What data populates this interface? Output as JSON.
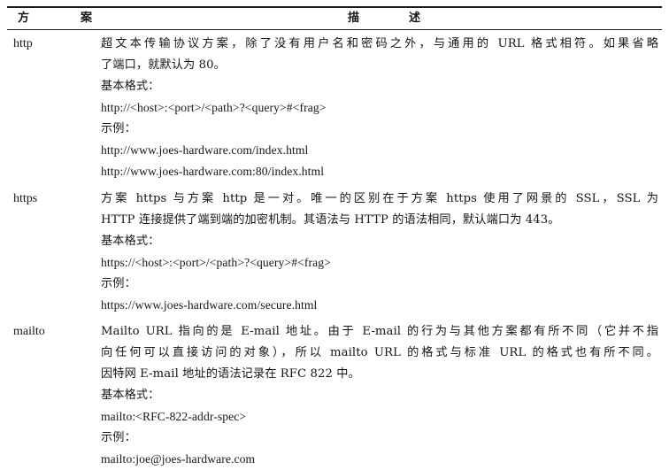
{
  "table": {
    "headers": {
      "scheme": [
        "方",
        "案"
      ],
      "description": [
        "描",
        "述"
      ]
    },
    "rows": [
      {
        "scheme": "http",
        "lines": [
          "超文本传输协议方案，除了没有用户名和密码之外，与通用的 URL 格式相符。如果省略",
          "了端口，就默认为 80。",
          "基本格式：",
          "http://<host>:<port>/<path>?<query>#<frag>",
          "示例：",
          "http://www.joes-hardware.com/index.html",
          "http://www.joes-hardware.com:80/index.html"
        ]
      },
      {
        "scheme": "https",
        "lines": [
          "方案 https 与方案 http 是一对。唯一的区别在于方案 https 使用了网景的 SSL，SSL 为",
          "HTTP 连接提供了端到端的加密机制。其语法与 HTTP 的语法相同，默认端口为 443。",
          "基本格式：",
          "https://<host>:<port>/<path>?<query>#<frag>",
          "示例：",
          "https://www.joes-hardware.com/secure.html"
        ]
      },
      {
        "scheme": "mailto",
        "lines": [
          "Mailto URL 指向的是 E-mail 地址。由于 E-mail 的行为与其他方案都有所不同（它并不指",
          "向任何可以直接访问的对象），所以 mailto URL 的格式与标准 URL 的格式也有所不同。",
          "因特网 E-mail 地址的语法记录在 RFC 822 中。",
          "基本格式：",
          "mailto:<RFC-822-addr-spec>",
          "示例：",
          "mailto:joe@joes-hardware.com"
        ]
      }
    ]
  }
}
